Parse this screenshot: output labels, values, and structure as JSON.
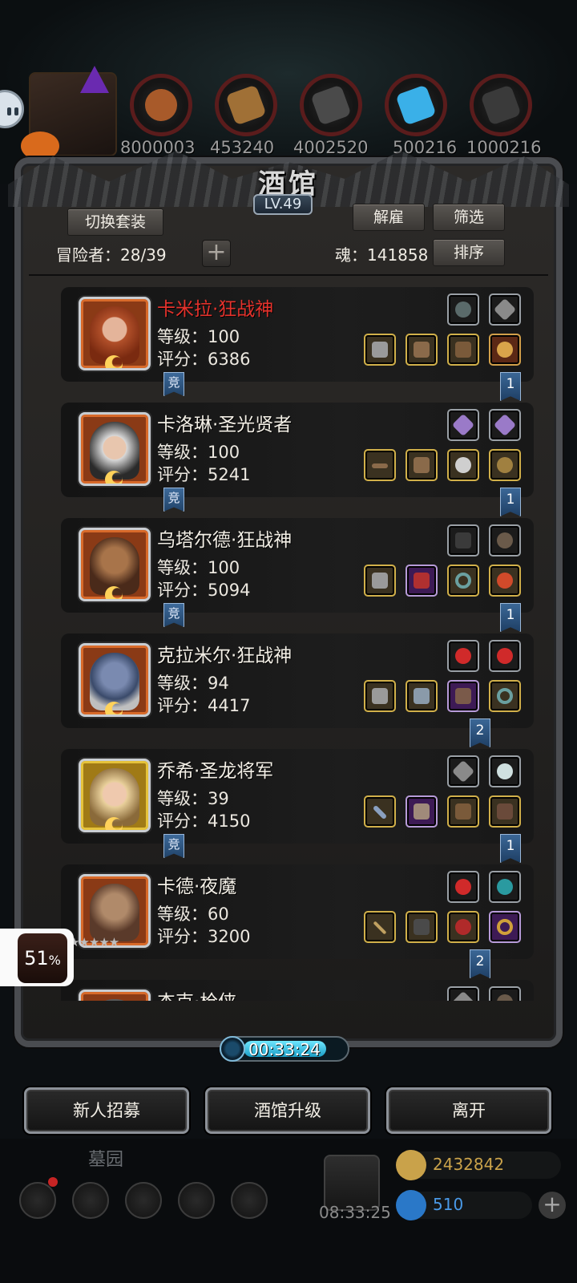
{
  "top_resources": {
    "values": [
      "8000003",
      "453240",
      "4002520",
      "500216",
      "1000216"
    ]
  },
  "panel": {
    "title": "酒馆",
    "level": "LV.49",
    "switch_outfit_label": "切换套装",
    "dismiss_label": "解雇",
    "filter_label": "筛选",
    "sort_label": "排序",
    "adventurers_text": "冒险者：28/39",
    "soul_text": "魂：141858"
  },
  "heroes": [
    {
      "name": "卡米拉·狂战神",
      "level": "等级：100",
      "score": "评分：6386",
      "tag": "竞",
      "rank": "1",
      "highlight": true
    },
    {
      "name": "卡洛琳·圣光贤者",
      "level": "等级：100",
      "score": "评分：5241",
      "tag": "竞",
      "rank": "1",
      "highlight": false
    },
    {
      "name": "乌塔尔德·狂战神",
      "level": "等级：100",
      "score": "评分：5094",
      "tag": "竞",
      "rank": "1",
      "highlight": false
    },
    {
      "name": "克拉米尔·狂战神",
      "level": "等级：94",
      "score": "评分：4417",
      "tag": "",
      "rank": "2",
      "highlight": false
    },
    {
      "name": "乔希·圣龙将军",
      "level": "等级：39",
      "score": "评分：4150",
      "tag": "竞",
      "rank": "1",
      "highlight": false
    },
    {
      "name": "卡德·夜魔",
      "level": "等级：60",
      "score": "评分：3200",
      "tag": "",
      "rank": "2",
      "highlight": false,
      "stars": "★★★★★"
    },
    {
      "name": "杰克·枪侠",
      "level": "",
      "score": "",
      "tag": "",
      "rank": "",
      "highlight": false
    }
  ],
  "timer": {
    "text": "00:33:24",
    "progress": 0.78
  },
  "bottom_buttons": {
    "recruit": "新人招募",
    "upgrade": "酒馆升级",
    "leave": "离开"
  },
  "underlay": {
    "area_name": "墓园",
    "gift_time": "08:33:25",
    "gold": "2432842",
    "gems": "510"
  },
  "overlay_badge": {
    "percent": "51",
    "unit": "%"
  },
  "colors": {
    "name_highlight": "#e5322c",
    "rank_tag": "#2f5a88",
    "accent_cyan": "#2bb8e0"
  }
}
